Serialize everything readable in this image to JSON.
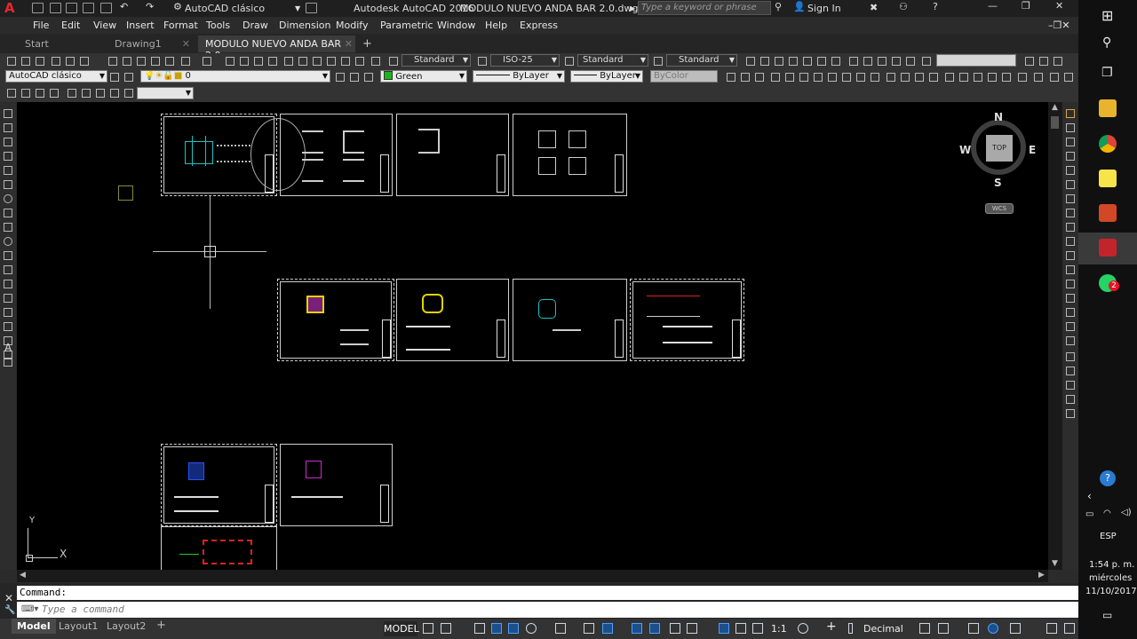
{
  "title_bar": {
    "workspace": "AutoCAD clásico",
    "app_title": "Autodesk AutoCAD 2016",
    "doc_title": "MODULO NUEVO ANDA BAR 2.0.dwg",
    "search_placeholder": "Type a keyword or phrase",
    "sign_in": "Sign In",
    "app_logo_letter": "A"
  },
  "menu": [
    "File",
    "Edit",
    "View",
    "Insert",
    "Format",
    "Tools",
    "Draw",
    "Dimension",
    "Modify",
    "Parametric",
    "Window",
    "Help",
    "Express"
  ],
  "file_tabs": [
    {
      "label": "Start",
      "active": false
    },
    {
      "label": "Drawing1",
      "active": false
    },
    {
      "label": "MODULO NUEVO ANDA BAR 2.0",
      "active": true
    }
  ],
  "styles_toolbar": {
    "text_style": "Standard",
    "dim_style": "ISO-25",
    "table_style": "Standard",
    "mleader_style": "Standard"
  },
  "layers_toolbar": {
    "workspace": "AutoCAD clásico",
    "layer": "0",
    "color": "Green",
    "linetype": "ByLayer",
    "lineweight": "ByLayer",
    "plotstyle": "ByColor"
  },
  "viewcube": {
    "n": "N",
    "s": "S",
    "e": "E",
    "w": "W",
    "face": "TOP",
    "ucs": "WCS"
  },
  "ucs_icon": {
    "x": "X",
    "y": "Y"
  },
  "command": {
    "history": "Command:",
    "placeholder": "Type a command"
  },
  "layout_tabs": [
    {
      "label": "Model",
      "active": true
    },
    {
      "label": "Layout1",
      "active": false
    },
    {
      "label": "Layout2",
      "active": false
    }
  ],
  "status": {
    "space": "MODEL",
    "scale": "1:1",
    "units": "Decimal"
  },
  "taskbar": {
    "lang": "ESP",
    "time": "1:54 p. m.",
    "day": "miércoles",
    "date": "11/10/2017",
    "badge": "2"
  },
  "colors": {
    "accent_blue": "#1c6fd1",
    "autocad_red": "#c3242b",
    "canvas": "#000000"
  }
}
